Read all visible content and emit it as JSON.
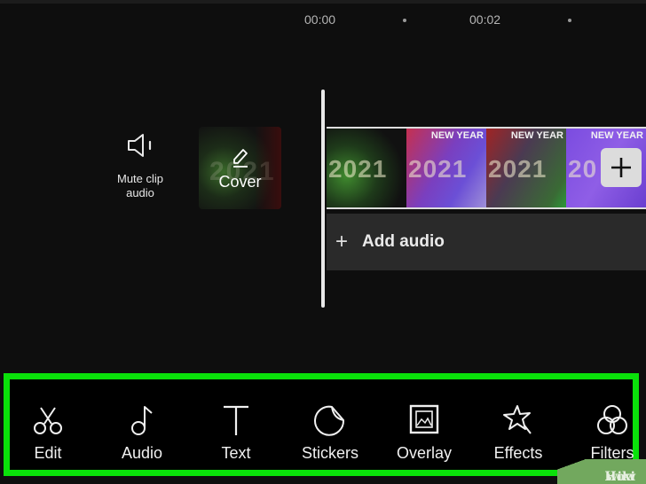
{
  "timeline": {
    "ruler": [
      "00:00",
      "00:02"
    ],
    "tracks": {
      "mute_clip_audio": "Mute clip audio",
      "cover": "Cover",
      "clip_frames": [
        {
          "year": "2021",
          "banner": ""
        },
        {
          "year": "2021",
          "banner": "NEW YEAR"
        },
        {
          "year": "2021",
          "banner": "NEW YEAR"
        },
        {
          "year": "20",
          "banner": "NEW YEAR"
        }
      ],
      "add_clip_icon": "plus-icon",
      "add_audio": "Add audio",
      "add_audio_icon": "+"
    }
  },
  "toolbar": {
    "items": [
      {
        "label": "Edit",
        "icon": "scissors-icon"
      },
      {
        "label": "Audio",
        "icon": "music-note-icon"
      },
      {
        "label": "Text",
        "icon": "text-icon"
      },
      {
        "label": "Stickers",
        "icon": "sticker-icon"
      },
      {
        "label": "Overlay",
        "icon": "overlay-icon"
      },
      {
        "label": "Effects",
        "icon": "star-wand-icon"
      },
      {
        "label": "Filters",
        "icon": "filters-icon"
      }
    ],
    "highlight_color": "#0ae10a"
  },
  "watermark": {
    "part1": "wiki",
    "part2": "How"
  }
}
